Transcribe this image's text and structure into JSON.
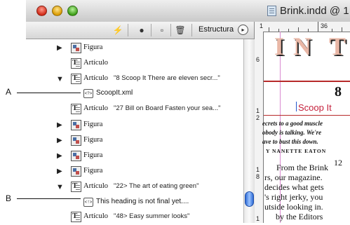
{
  "window": {
    "title": "Brink.indd @ 1"
  },
  "structure_pane": {
    "toolbar": {
      "structure_label": "Estructura",
      "menu_button": "▸"
    },
    "rows": [
      {
        "tag": "Figura",
        "text": ""
      },
      {
        "tag": "Artículo",
        "text": ""
      },
      {
        "tag": "Artículo",
        "text": "\"8 Scoop It There are eleven secr...\""
      },
      {
        "tag": "",
        "text": "ScoopIt.xml"
      },
      {
        "tag": "Artículo",
        "text": "\"27 Bill on Board Fasten your sea...\""
      },
      {
        "tag": "Figura",
        "text": ""
      },
      {
        "tag": "Figura",
        "text": ""
      },
      {
        "tag": "Figura",
        "text": ""
      },
      {
        "tag": "Figura",
        "text": ""
      },
      {
        "tag": "Artículo",
        "text": "\"22> The  art of eating green\""
      },
      {
        "tag": "",
        "text": "This heading is not final yet...."
      },
      {
        "tag": "Artículo",
        "text": "\"48> Easy summer looks\""
      }
    ]
  },
  "document": {
    "ruler_top": [
      "1",
      "36"
    ],
    "ruler_left": [
      "6",
      "1",
      "2",
      "1",
      "8",
      "1",
      "2"
    ],
    "headline_letters": [
      "I",
      "N",
      "T"
    ],
    "number": "8",
    "subhead": "Scoop It",
    "italic_lines": [
      "ecrets to a good muscle",
      "obody is talking. We're",
      "ave to bust this down."
    ],
    "byline": "Y NANETTE EATON",
    "page_number": "12",
    "body_lines": [
      "From the Brink",
      "rs, our magazine.",
      "decides what gets",
      "'s right jerky, you",
      "utside looking in.",
      "by the Editors"
    ]
  },
  "callouts": {
    "a": "A",
    "b": "B"
  }
}
